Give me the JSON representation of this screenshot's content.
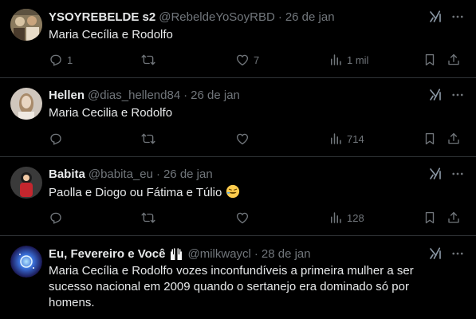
{
  "tweets": [
    {
      "name": "YSOYREBELDE s2",
      "handle": "@RebeldeYoSoyRBD",
      "dot": "·",
      "date": "26 de jan",
      "text": "Maria Cecília e Rodolfo",
      "replies": "1",
      "retweets": "",
      "likes": "7",
      "views": "1 mil"
    },
    {
      "name": "Hellen",
      "handle": "@dias_hellend84",
      "dot": "·",
      "date": "26 de jan",
      "text": "Maria Cecilia e Rodolfo",
      "replies": "",
      "retweets": "",
      "likes": "",
      "views": "714"
    },
    {
      "name": "Babita",
      "handle": "@babita_eu",
      "dot": "·",
      "date": "26 de jan",
      "text": "Paolla e Diogo ou Fátima e Túlio",
      "replies": "",
      "retweets": "",
      "likes": "",
      "views": "128"
    },
    {
      "name": "Eu, Fevereiro e Você",
      "handle": "@milkwaycl",
      "dot": "·",
      "date": "28 de jan",
      "text": "Maria Cecília e Rodolfo vozes inconfundíveis a primeira mulher a ser sucesso nacional em 2009 quando o sertanejo era dominado só por homens."
    }
  ],
  "icons": {
    "reply": "reply-icon",
    "retweet": "retweet-icon",
    "like": "heart-icon",
    "views": "views-icon",
    "bookmark": "bookmark-icon",
    "share": "share-icon",
    "grok": "grok-icon",
    "more": "more-icon"
  },
  "colors": {
    "background": "#000000",
    "text": "#e7e9ea",
    "muted": "#71767b",
    "divider": "#2f3336"
  }
}
